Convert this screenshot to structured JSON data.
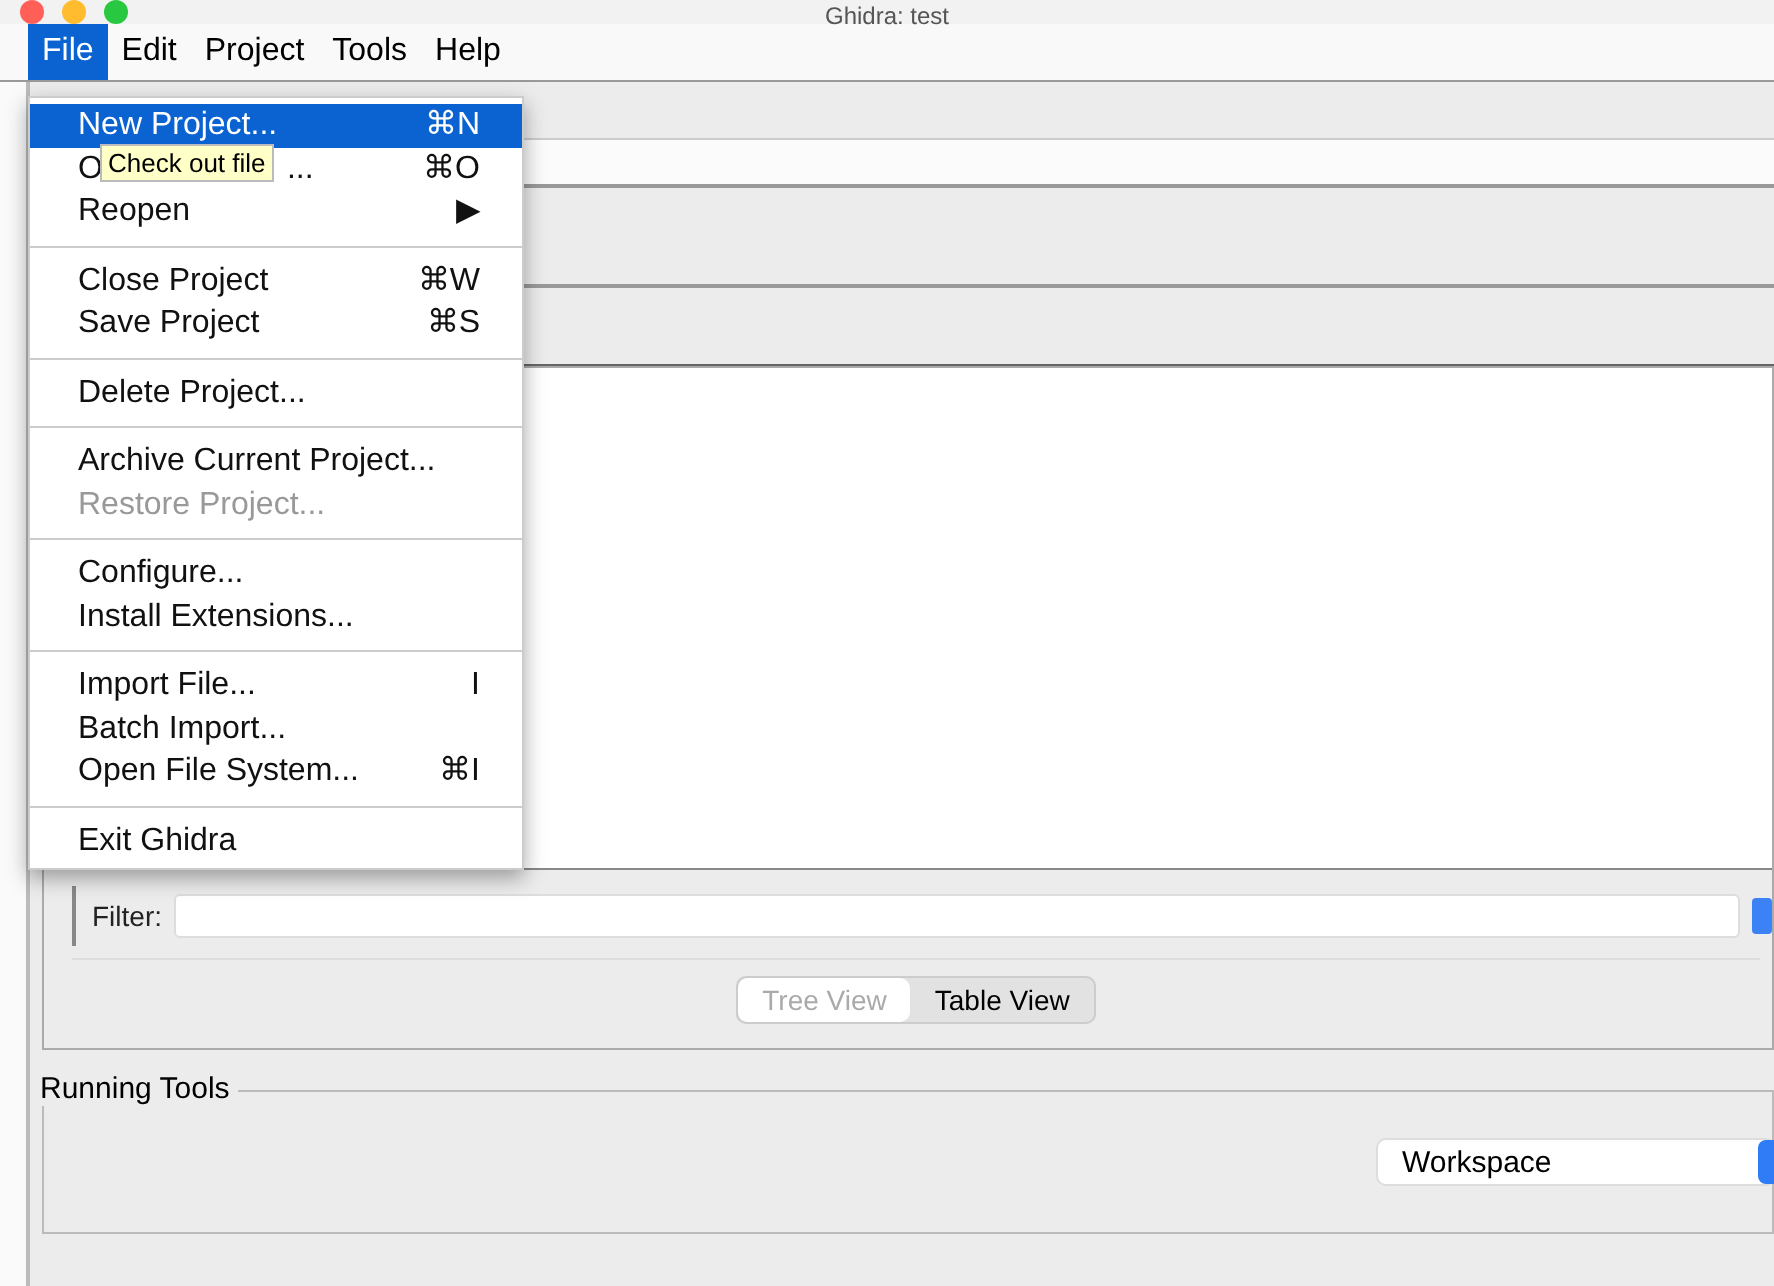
{
  "window": {
    "title": "Ghidra: test"
  },
  "menubar": [
    {
      "label": "File",
      "selected": true
    },
    {
      "label": "Edit",
      "selected": false
    },
    {
      "label": "Project",
      "selected": false
    },
    {
      "label": "Tools",
      "selected": false
    },
    {
      "label": "Help",
      "selected": false
    }
  ],
  "file_menu": [
    {
      "kind": "item",
      "label": "New Project...",
      "shortcut": "⌘N",
      "selected": true,
      "disabled": false
    },
    {
      "kind": "covered",
      "label": "O",
      "tail": "...",
      "shortcut": "⌘O",
      "selected": false,
      "disabled": false
    },
    {
      "kind": "item",
      "label": "Reopen",
      "shortcut": "▶",
      "selected": false,
      "disabled": false
    },
    {
      "kind": "separator"
    },
    {
      "kind": "item",
      "label": "Close Project",
      "shortcut": "⌘W",
      "selected": false,
      "disabled": false
    },
    {
      "kind": "item",
      "label": "Save Project",
      "shortcut": "⌘S",
      "selected": false,
      "disabled": false
    },
    {
      "kind": "separator"
    },
    {
      "kind": "item",
      "label": "Delete Project...",
      "selected": false,
      "disabled": false
    },
    {
      "kind": "separator"
    },
    {
      "kind": "item",
      "label": "Archive Current Project...",
      "selected": false,
      "disabled": false
    },
    {
      "kind": "item",
      "label": "Restore Project...",
      "selected": false,
      "disabled": true
    },
    {
      "kind": "separator"
    },
    {
      "kind": "item",
      "label": "Configure...",
      "selected": false,
      "disabled": false
    },
    {
      "kind": "item",
      "label": "Install Extensions...",
      "selected": false,
      "disabled": false
    },
    {
      "kind": "separator"
    },
    {
      "kind": "item",
      "label": "Import File...",
      "shortcut": "I",
      "selected": false,
      "disabled": false
    },
    {
      "kind": "item",
      "label": "Batch Import...",
      "selected": false,
      "disabled": false
    },
    {
      "kind": "item",
      "label": "Open File System...",
      "shortcut": "⌘I",
      "selected": false,
      "disabled": false
    },
    {
      "kind": "separator"
    },
    {
      "kind": "item",
      "label": "Exit Ghidra",
      "selected": false,
      "disabled": false
    }
  ],
  "tooltip": "Check out file",
  "filter": {
    "label": "Filter:"
  },
  "view_toggle": [
    {
      "label": "Tree View",
      "selected": true
    },
    {
      "label": "Table View",
      "selected": false
    }
  ],
  "running_tools": {
    "title": "Running Tools",
    "workspace": "Workspace"
  }
}
